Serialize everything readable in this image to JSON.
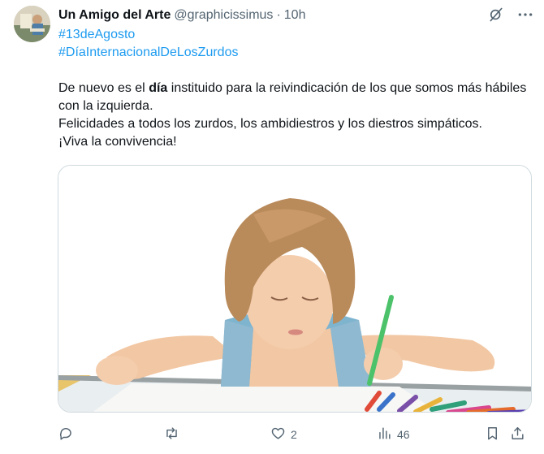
{
  "tweet": {
    "author_name": "Un Amigo del Arte",
    "handle": "@graphicissimus",
    "separator": "·",
    "time": "10h",
    "hashtags": [
      "#13deAgosto",
      "#DíaInternacionalDeLosZurdos"
    ],
    "line1_prefix": "De nuevo es el ",
    "line1_bold": "día",
    "line1_rest": " instituido para la reivindicación de los que somos más hábiles con la izquierda.",
    "line2": "Felicidades a todos los zurdos, los ambidiestros y los diestros simpáticos.",
    "line3": "¡Viva la convivencia!"
  },
  "icons": {
    "top": [
      "grok-icon",
      "more-icon"
    ],
    "actions": [
      "reply-icon",
      "retweet-icon",
      "like-icon",
      "views-icon",
      "bookmark-icon",
      "share-icon"
    ]
  },
  "actions": {
    "reply_count": "",
    "retweet_count": "",
    "like_count": "2",
    "views_count": "46"
  },
  "colors": {
    "link": "#1d9bf0",
    "secondary_text": "#536471",
    "text": "#0f1419",
    "border": "#cfd9de"
  }
}
